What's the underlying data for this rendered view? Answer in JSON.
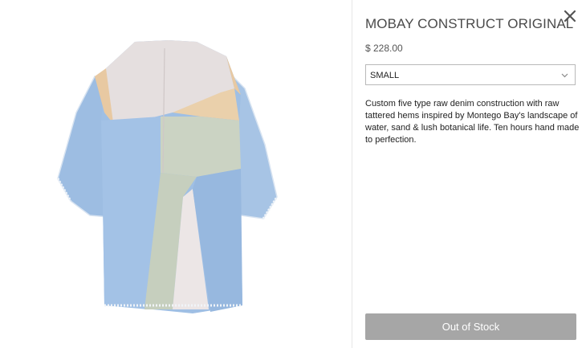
{
  "product": {
    "title": "MOBAY CONSTRUCT ORIGINAL",
    "price": "$ 228.00",
    "size_selected": "SMALL",
    "description": "Custom five type raw denim construction with raw tattered hems inspired by Montego Bay's landscape of water, sand & lush botanical life.  Ten hours hand made to perfection.",
    "stock_button_label": "Out of Stock"
  },
  "icons": {
    "close": "close-icon",
    "select_caret": "chevron-down-icon"
  },
  "colors": {
    "denim_light": "#a9c6e6",
    "denim_mid": "#8fb3dc",
    "canvas": "#e4dcdc",
    "sage": "#c9d2c1",
    "sand": "#e8c9a2",
    "button_disabled": "#a6a6a6"
  }
}
